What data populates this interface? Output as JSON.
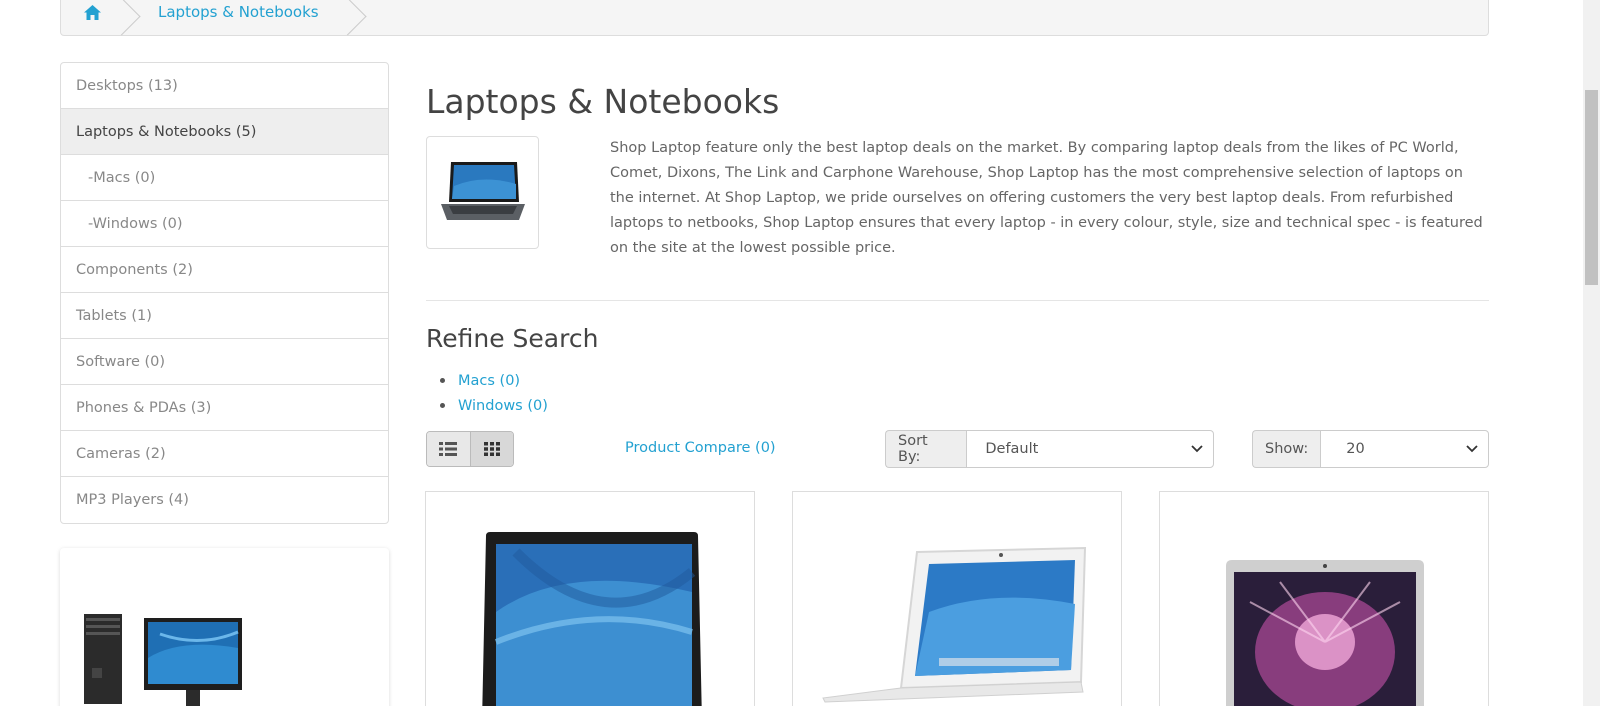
{
  "breadcrumb": {
    "home_icon": "home-icon",
    "current": "Laptops & Notebooks"
  },
  "sidebar": {
    "categories": [
      {
        "label": "Desktops (13)"
      },
      {
        "label": "Laptops & Notebooks (5)"
      },
      {
        "label": "-Macs (0)"
      },
      {
        "label": "-Windows (0)"
      },
      {
        "label": "Components (2)"
      },
      {
        "label": "Tablets (1)"
      },
      {
        "label": "Software (0)"
      },
      {
        "label": "Phones & PDAs (3)"
      },
      {
        "label": "Cameras (2)"
      },
      {
        "label": "MP3 Players (4)"
      }
    ]
  },
  "main": {
    "title": "Laptops & Notebooks",
    "description": "Shop Laptop feature only the best laptop deals on the market. By comparing laptop deals from the likes of PC World, Comet, Dixons, The Link and Carphone Warehouse, Shop Laptop has the most comprehensive selection of laptops on the internet. At Shop Laptop, we pride ourselves on offering customers the very best laptop deals. From refurbished laptops to netbooks, Shop Laptop ensures that every laptop - in every colour, style, size and technical spec - is featured on the site at the lowest possible price.",
    "refine_title": "Refine Search",
    "refine_links": [
      {
        "label": "Macs (0)"
      },
      {
        "label": "Windows (0)"
      }
    ]
  },
  "toolbar": {
    "list_icon": "list-view-icon",
    "grid_icon": "grid-view-icon",
    "compare_label": "Product Compare (0)",
    "sort_label": "Sort By:",
    "sort_value": "Default",
    "show_label": "Show:",
    "show_value": "20"
  },
  "colors": {
    "link": "#23a1d1",
    "active_bg": "#eeeeee",
    "border": "#dddddd"
  }
}
